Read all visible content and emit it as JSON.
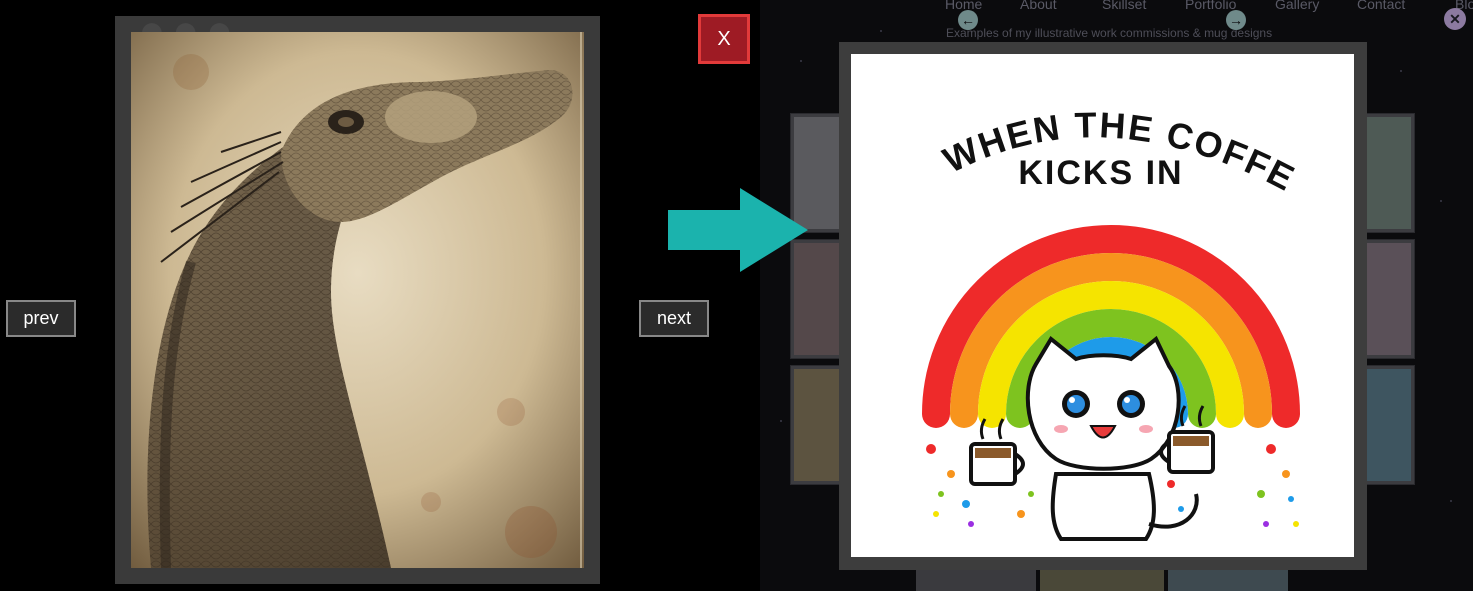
{
  "left_lightbox": {
    "prev_label": "prev",
    "next_label": "next",
    "close_label": "X",
    "image_alt": "Sepia pencil drawing of a lizard head"
  },
  "right_page": {
    "nav": [
      "Home",
      "About",
      "Skillset",
      "Portfolio",
      "Gallery",
      "Contact",
      "Blog"
    ],
    "subtitle": "Examples of my illustrative work commissions & mug designs"
  },
  "right_lightbox": {
    "image_text_line1": "WHEN THE COFFEE",
    "image_text_line2": "KICKS IN"
  },
  "colors": {
    "close_button": "#9e1b24",
    "close_border": "#e23a3a",
    "arrow": "#1bb3ad",
    "frame": "#3d3d3d"
  },
  "icons": {
    "nav_prev": "arrow-left-icon",
    "nav_next": "arrow-right-icon",
    "close": "close-icon",
    "pointer": "arrow-right-icon"
  }
}
